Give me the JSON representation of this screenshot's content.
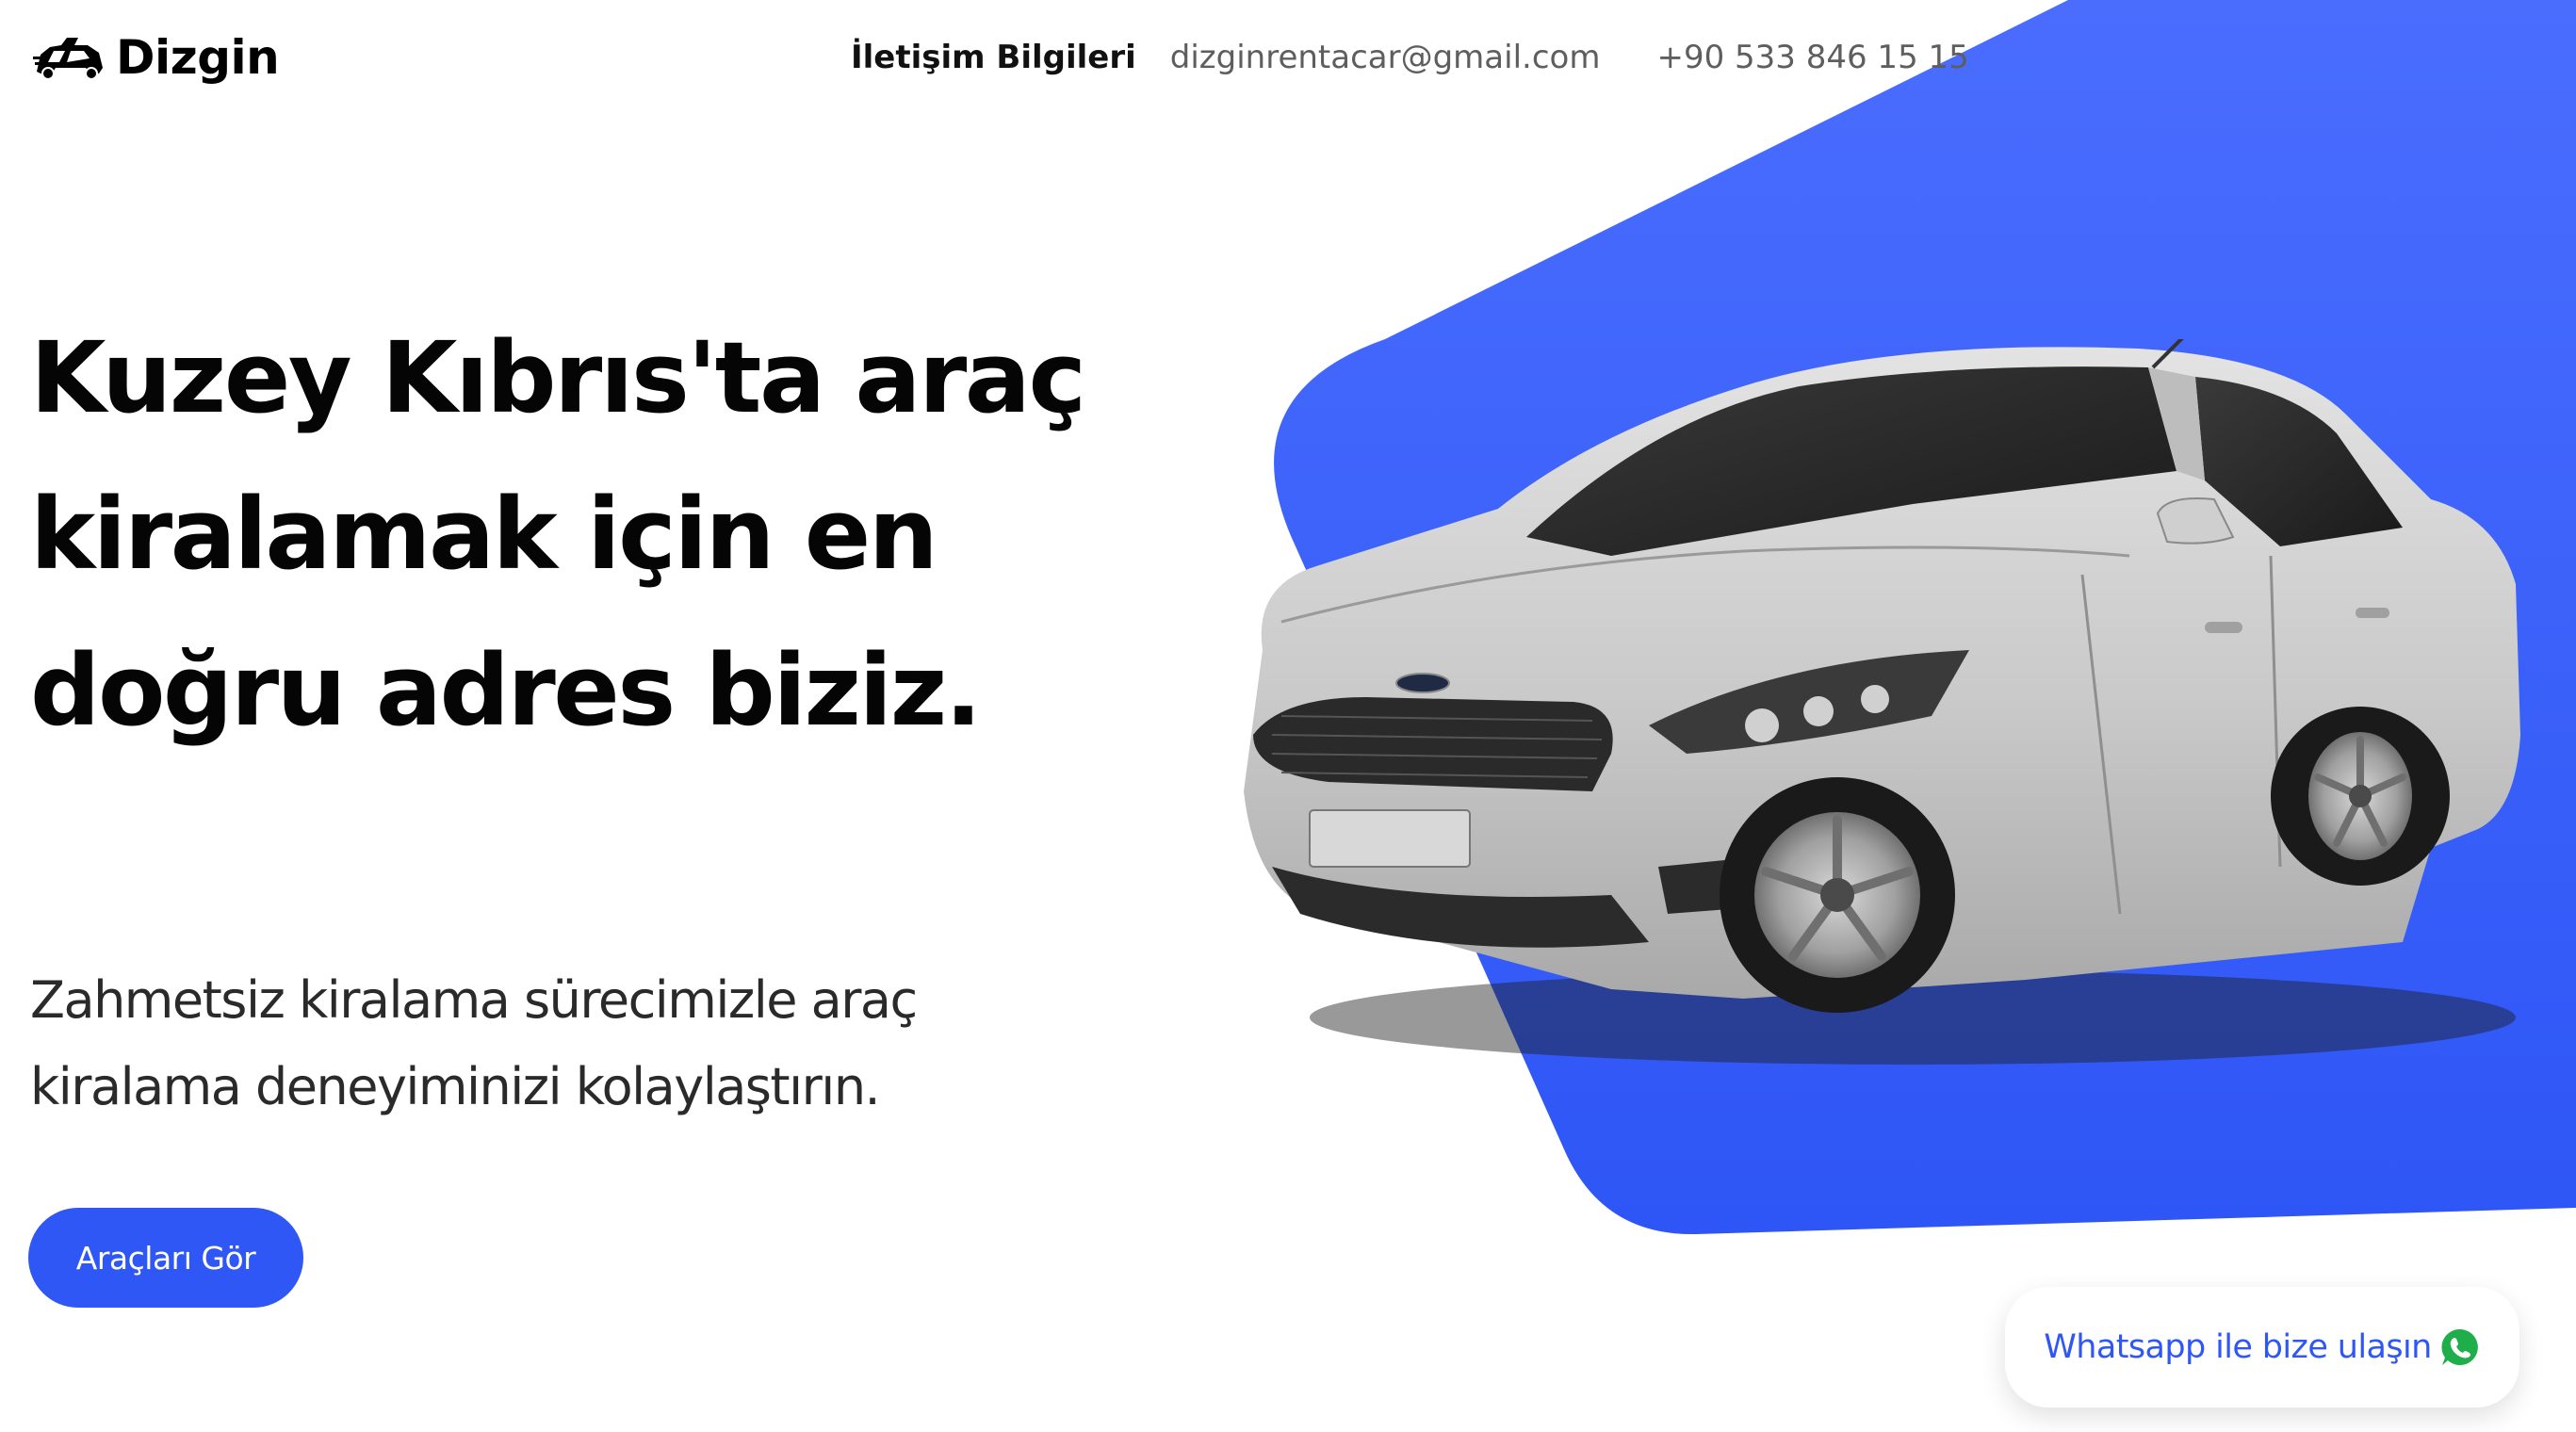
{
  "brand": {
    "name": "Dizgin",
    "logo_icon": "car-speed-logo-icon"
  },
  "header": {
    "contact_title": "İletişim Bilgileri",
    "email": "dizginrentacar@gmail.com",
    "phone": "+90 533 846 15 15"
  },
  "hero": {
    "title": "Kuzey Kıbrıs'ta araç kiralamak için en doğru adres biziz.",
    "subtitle": "Zahmetsiz kiralama sürecimizle araç kiralama deneyiminizi kolaylaştırın.",
    "cta_label": "Araçları Gör",
    "image": "silver-sedan-car"
  },
  "whatsapp": {
    "label": "Whatsapp ile bize ulaşın",
    "icon": "whatsapp-icon"
  },
  "colors": {
    "accent": "#2f57f5",
    "accent_light": "#4d6fff",
    "text": "#050505",
    "muted": "#5e5e5e"
  }
}
